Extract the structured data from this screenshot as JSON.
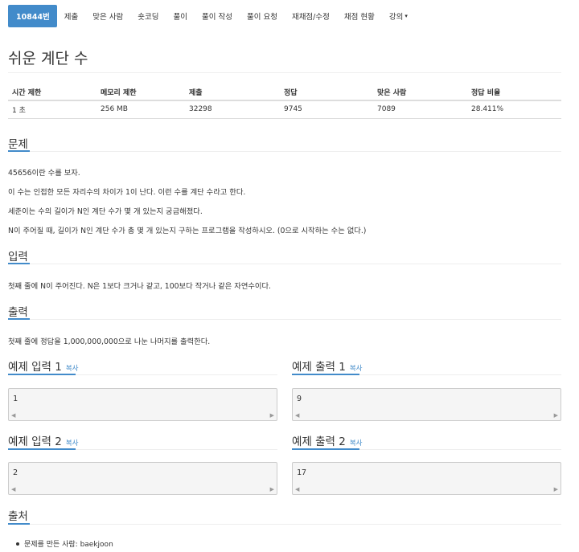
{
  "nav": {
    "tabs": [
      {
        "label": "10844번"
      },
      {
        "label": "제출"
      },
      {
        "label": "맞은 사람"
      },
      {
        "label": "숏코딩"
      },
      {
        "label": "풀이"
      },
      {
        "label": "풀이 작성"
      },
      {
        "label": "풀이 요청"
      },
      {
        "label": "재채점/수정"
      },
      {
        "label": "채점 현황"
      },
      {
        "label": "강의"
      }
    ],
    "active_tab": "10844번"
  },
  "problem": {
    "title": "쉬운 계단 수"
  },
  "info": {
    "headers": [
      "시간 제한",
      "메모리 제한",
      "제출",
      "정답",
      "맞은 사람",
      "정답 비율"
    ],
    "values": [
      "1 초",
      "256 MB",
      "32298",
      "9745",
      "7089",
      "28.411%"
    ]
  },
  "sections": {
    "description": {
      "heading": "문제",
      "lines": [
        "45656이란 수를 보자.",
        "이 수는 인접한 모든 자리수의 차이가 1이 난다. 이런 수를 계단 수라고 한다.",
        "세준이는 수의 길이가 N인 계단 수가 몇 개 있는지 궁금해졌다.",
        "N이 주어질 때, 길이가 N인 계단 수가 총 몇 개 있는지 구하는 프로그램을 작성하시오. (0으로 시작하는 수는 없다.)"
      ]
    },
    "input": {
      "heading": "입력",
      "text": "첫째 줄에 N이 주어진다. N은 1보다 크거나 같고, 100보다 작거나 같은 자연수이다."
    },
    "output": {
      "heading": "출력",
      "text": "첫째 줄에 정답을 1,000,000,000으로 나눈 나머지를 출력한다."
    }
  },
  "samples": [
    {
      "input_label": "예제 입력 1",
      "output_label": "예제 출력 1",
      "input": "1",
      "output": "9"
    },
    {
      "input_label": "예제 입력 2",
      "output_label": "예제 출력 2",
      "input": "2",
      "output": "17"
    }
  ],
  "copy_label": "복사",
  "source": {
    "heading": "출처",
    "items": [
      "문제를 만든 사람: baekjoon"
    ]
  },
  "colors": {
    "accent": "#428bca",
    "sample_bg": "#f5f5f5",
    "rule": "#eeeeee"
  }
}
